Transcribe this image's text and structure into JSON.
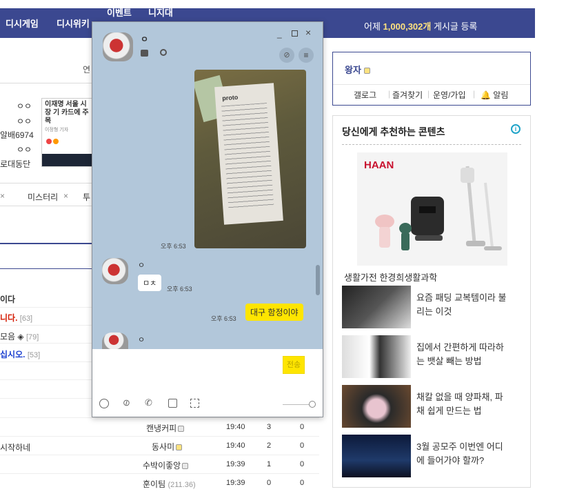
{
  "topbar": {
    "nav": [
      "디시게임",
      "디시위키",
      "이벤트",
      "니지대"
    ],
    "notice_prefix": "어제",
    "notice_count": "1,000,302개",
    "notice_suffix": "게시글 등록"
  },
  "left_page": {
    "tab_partial": "연",
    "news_items": [
      "ㅇㅇ",
      "ㅇㅇ",
      "알배6974",
      "ㅇㅇ",
      "로대동단"
    ],
    "news_card_title": "이재명 서울 시장 기 카드에 주목",
    "news_card_meta": "이정형 기자",
    "filter_tags": [
      "미스터리",
      "투"
    ],
    "board_rows": [
      {
        "text": "이다",
        "style": "bold",
        "count": ""
      },
      {
        "text": "니다.",
        "style": "red",
        "count": "[63]"
      },
      {
        "text": "모음 ◈",
        "style": "normal",
        "count": "[79]"
      },
      {
        "text": "십시오.",
        "style": "blue",
        "count": "[53]"
      }
    ],
    "post_rows": [
      {
        "title": "",
        "author": "캔냉커피",
        "time": "19:40",
        "views": "3",
        "recs": "0"
      },
      {
        "title": "시작하네",
        "author": "동사미",
        "time": "19:40",
        "views": "2",
        "recs": "0"
      },
      {
        "title": "",
        "author": "수박이좋앙",
        "time": "19:39",
        "views": "1",
        "recs": "0"
      },
      {
        "title": "",
        "author": "훈이팀",
        "author_ip": "(211.36)",
        "time": "19:39",
        "views": "0",
        "recs": "0"
      }
    ]
  },
  "userbox": {
    "username": "왕자",
    "links": [
      "갤로그",
      "즐겨찾기",
      "운영/가입",
      "알림"
    ]
  },
  "recommend": {
    "title": "당신에게 추천하는 콘텐츠",
    "ad_brand": "HAAN",
    "ad_caption": "생활가전 한경희생활과학",
    "items": [
      {
        "line1": "요즘 패딩 교복템이라 불",
        "line2": "리는 이것"
      },
      {
        "line1": "집에서 간편하게 따라하",
        "line2": "는 뱃살 빼는 방법"
      },
      {
        "line1": "채칼 없을 때 양파채, 파",
        "line2": "채 쉽게 만드는 법"
      },
      {
        "line1": "3월 공모주 이번엔 어디",
        "line2": "에 들어가야 할까?"
      }
    ]
  },
  "chat": {
    "name": "ㅇ",
    "messages": [
      {
        "side": "right",
        "type": "image",
        "time": "오후 6:53",
        "receipt_brand": "proto"
      },
      {
        "side": "left",
        "sender": "ㅇ",
        "text": "ㅁㅊ",
        "time": "오후 6:53"
      },
      {
        "side": "right",
        "text": "대구 함정이야",
        "time": "오후 6:53"
      },
      {
        "side": "left",
        "sender": "ㅇ",
        "text": ""
      }
    ],
    "send_label": "전송"
  },
  "colors": {
    "brand": "#3b4890",
    "chat_bg": "#b2c7da",
    "bubble_mine": "#fee500",
    "notice_num": "#ffe37f"
  }
}
